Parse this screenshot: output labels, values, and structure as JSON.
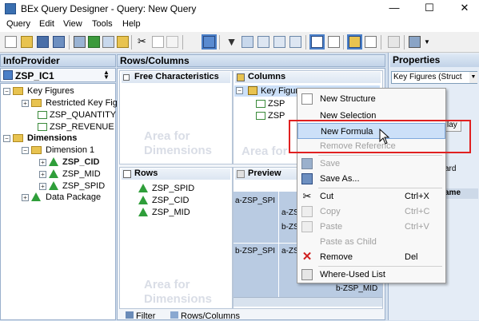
{
  "window": {
    "title": "BEx Query Designer - Query: New Query",
    "minimize": "—",
    "maximize": "☐",
    "close": "✕"
  },
  "menubar": {
    "items": [
      "Query",
      "Edit",
      "View",
      "Tools",
      "Help"
    ]
  },
  "infoprovider": {
    "header": "InfoProvider",
    "root": "ZSP_IC1",
    "key_figures": "Key Figures",
    "restricted": "Restricted Key Fig",
    "kf1": "ZSP_QUANTITY",
    "kf2": "ZSP_REVENUE",
    "dimensions": "Dimensions",
    "dimension1": "Dimension 1",
    "d1": "ZSP_CID",
    "d2": "ZSP_MID",
    "d3": "ZSP_SPID",
    "data_package": "Data Package"
  },
  "rowscols": {
    "header": "Rows/Columns",
    "free_char": "Free Characteristics",
    "free_area_1": "Area for",
    "free_area_2": "Dimensions",
    "columns": "Columns",
    "col_item": "Key Figure",
    "col_sub1": "ZSP",
    "col_sub2": "ZSP",
    "col_area": "Area for",
    "rows": "Rows",
    "row1": "ZSP_SPID",
    "row2": "ZSP_CID",
    "row3": "ZSP_MID",
    "rows_area_1": "Area for",
    "rows_area_2": "Dimensions",
    "preview": "Preview",
    "pv_a1": "a-ZSP_SPI",
    "pv_a2": "a-ZSP_",
    "pv_b1": "b-ZSP_SPI",
    "pv_b2": "b-ZSP_",
    "pv_a3": "a-ZSP_",
    "pv_mid": "b-ZSP_MID",
    "tab_filter": "Filter",
    "tab_rows": "Rows/Columns"
  },
  "properties": {
    "header": "Properties",
    "select": "Key Figures (Struct",
    "tab": "lay",
    "lbl1": "ard",
    "lbl2": "ame"
  },
  "context_menu": {
    "new_structure": "New Structure",
    "new_selection": "New Selection",
    "new_formula": "New Formula",
    "remove_reference": "Remove Reference",
    "save": "Save",
    "save_as": "Save As...",
    "cut": "Cut",
    "cut_sc": "Ctrl+X",
    "copy": "Copy",
    "copy_sc": "Ctrl+C",
    "paste": "Paste",
    "paste_sc": "Ctrl+V",
    "paste_as_child": "Paste as Child",
    "remove": "Remove",
    "remove_sc": "Del",
    "where_used": "Where-Used List"
  },
  "colors": {
    "highlight": "#cce0f8",
    "red_box": "#e02020",
    "pane_bg": "#d4e0ee",
    "dim_green": "#2f9e3a"
  }
}
